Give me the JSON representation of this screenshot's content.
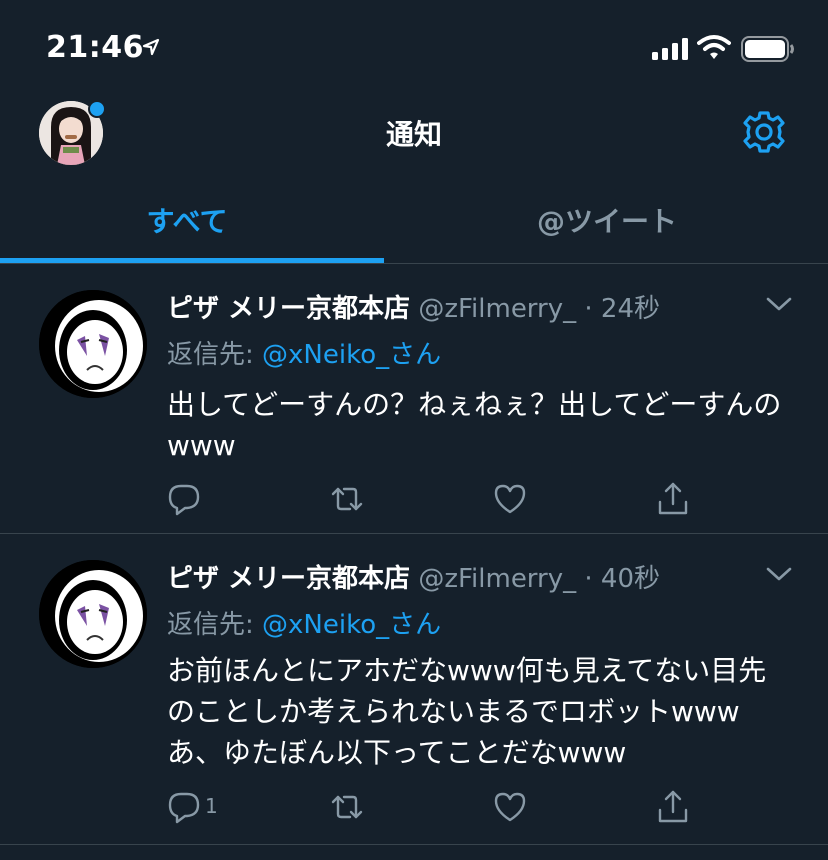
{
  "status_bar": {
    "time": "21:46"
  },
  "header": {
    "title": "通知"
  },
  "tabs": [
    {
      "label": "すべて"
    },
    {
      "label": "@ツイート"
    }
  ],
  "tweets": [
    {
      "name": "ピザ メリー京都本店",
      "handle": "@zFilmerry_",
      "separator": "·",
      "time": "24秒",
      "reply_prefix": "返信先:",
      "reply_to": "@xNeiko_さん",
      "text": "出してどーすんの？ねぇねぇ？出してどーすんのwww",
      "reply_count": ""
    },
    {
      "name": "ピザ メリー京都本店",
      "handle": "@zFilmerry_",
      "separator": "·",
      "time": "40秒",
      "reply_prefix": "返信先:",
      "reply_to": "@xNeiko_さん",
      "text": "お前ほんとにアホだなwww何も見えてない目先のことしか考えられないまるでロボットwwwあ、ゆたぼん以下ってことだなwww",
      "reply_count": "1"
    }
  ],
  "colors": {
    "background": "#15202b",
    "accent": "#1da1f2",
    "secondary_text": "#8899a6",
    "divider": "#38444d"
  },
  "icons": [
    "location-arrow-icon",
    "signal-icon",
    "wifi-icon",
    "battery-icon",
    "gear-icon",
    "chevron-down-icon",
    "reply-icon",
    "retweet-icon",
    "like-icon",
    "share-icon"
  ]
}
